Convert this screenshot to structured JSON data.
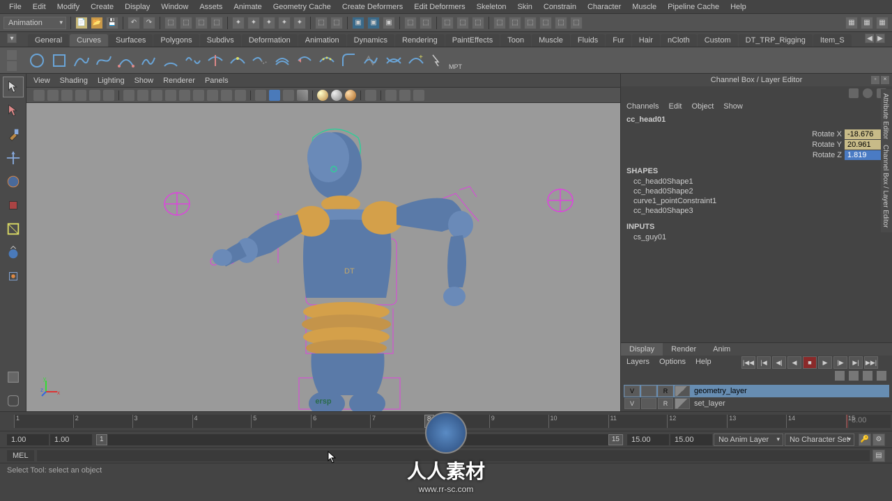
{
  "menubar": [
    "File",
    "Edit",
    "Modify",
    "Create",
    "Display",
    "Window",
    "Assets",
    "Animate",
    "Geometry Cache",
    "Create Deformers",
    "Edit Deformers",
    "Skeleton",
    "Skin",
    "Constrain",
    "Character",
    "Muscle",
    "Pipeline Cache",
    "Help"
  ],
  "toolbar1": {
    "mode": "Animation"
  },
  "shelf": {
    "tabs": [
      "General",
      "Curves",
      "Surfaces",
      "Polygons",
      "Subdivs",
      "Deformation",
      "Animation",
      "Dynamics",
      "Rendering",
      "PaintEffects",
      "Toon",
      "Muscle",
      "Fluids",
      "Fur",
      "Hair",
      "nCloth",
      "Custom",
      "DT_TRP_Rigging",
      "Item_S"
    ],
    "active": 1,
    "mpt_label": "MPT"
  },
  "viewport": {
    "menus": [
      "View",
      "Shading",
      "Lighting",
      "Show",
      "Renderer",
      "Panels"
    ],
    "camera": "ersp",
    "dt_label": "DT"
  },
  "channelBox": {
    "title": "Channel Box / Layer Editor",
    "menus": [
      "Channels",
      "Edit",
      "Object",
      "Show"
    ],
    "object": "cc_head01",
    "attrs": [
      {
        "label": "Rotate X",
        "value": "-18.676",
        "sel": false
      },
      {
        "label": "Rotate Y",
        "value": "20.961",
        "sel": false
      },
      {
        "label": "Rotate Z",
        "value": "1.819",
        "sel": true
      }
    ],
    "shapes_label": "SHAPES",
    "shapes": [
      "cc_head0Shape1",
      "cc_head0Shape2",
      "curve1_pointConstraint1",
      "cc_head0Shape3"
    ],
    "inputs_label": "INPUTS",
    "inputs": [
      "cs_guy01"
    ]
  },
  "layers": {
    "tabs": [
      "Display",
      "Render",
      "Anim"
    ],
    "active": 0,
    "menus": [
      "Layers",
      "Options",
      "Help"
    ],
    "rows": [
      {
        "v": "V",
        "r": "R",
        "name": "geometry_layer",
        "sel": true
      },
      {
        "v": "V",
        "r": "R",
        "name": "set_layer",
        "sel": false
      }
    ]
  },
  "sideTabs": [
    "Attribute Editor",
    "Channel Box / Layer Editor"
  ],
  "timeline": {
    "ticks": [
      1,
      2,
      3,
      4,
      5,
      6,
      7,
      8,
      9,
      10,
      11,
      12,
      13,
      14,
      15
    ],
    "current": 8,
    "end": 15,
    "frameField": "8.00"
  },
  "range": {
    "startOuter": "1.00",
    "startInner": "1.00",
    "handleStart": "1",
    "handleEnd": "15",
    "endInner": "15.00",
    "endOuter": "15.00",
    "animLayer": "No Anim Layer",
    "charSet": "No Character Set"
  },
  "cmd": {
    "label": "MEL"
  },
  "status": "Select Tool: select an object",
  "watermark": {
    "text": "人人素材",
    "url": "www.rr-sc.com"
  }
}
